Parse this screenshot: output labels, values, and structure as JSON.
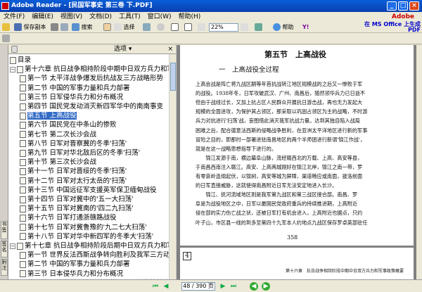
{
  "window": {
    "title": "Adobe Reader - [民国军事史 第三卷 下.PDF]",
    "min": "_",
    "max": "□",
    "close": "×"
  },
  "menu": {
    "items": [
      "文件(F)",
      "编辑(E)",
      "视图(V)",
      "文档(D)",
      "工具(T)",
      "窗口(W)",
      "帮助(H)"
    ],
    "brand": "Adobe"
  },
  "toolbar1": {
    "save_copy": "保存副本",
    "search": "搜索",
    "select": "选择",
    "zoom": "22%",
    "help": "帮助",
    "yahoo": "Y!"
  },
  "ad": {
    "line1": "在 MS Office 上生成",
    "line2": "PDF"
  },
  "sidebar": {
    "options": "选项",
    "tabs": [
      "书签",
      "签名",
      "附注"
    ],
    "items": [
      {
        "label": "目录",
        "level": 0,
        "toggle": ""
      },
      {
        "label": "第十六章 抗日战争相持阶段中期中日双方兵力和军",
        "level": 0,
        "toggle": "−"
      },
      {
        "label": "第一节 太平洋战争爆发后抗战友三方战略形势",
        "level": 1,
        "toggle": ""
      },
      {
        "label": "第二节 中国的军事力量和兵力部署",
        "level": 1,
        "toggle": ""
      },
      {
        "label": "第三节 日军侵华兵力和分布概况",
        "level": 1,
        "toggle": ""
      },
      {
        "label": "第四节 国民党发动消灭新四军华中的南南事变",
        "level": 1,
        "toggle": ""
      },
      {
        "label": "第五节 上高战役",
        "level": 1,
        "toggle": "",
        "selected": true
      },
      {
        "label": "第六节 国民党在中条山的惨败",
        "level": 1,
        "toggle": ""
      },
      {
        "label": "第七节 第二次长沙会战",
        "level": 1,
        "toggle": ""
      },
      {
        "label": "第八节 日军对晋察冀的冬季'扫荡'",
        "level": 1,
        "toggle": ""
      },
      {
        "label": "第九节 日军对华北敌后区的冬季'扫荡'",
        "level": 1,
        "toggle": ""
      },
      {
        "label": "第十节 第三次长沙会战",
        "level": 1,
        "toggle": ""
      },
      {
        "label": "第十一节 日军对晋绥的冬季'扫荡'",
        "level": 1,
        "toggle": ""
      },
      {
        "label": "第十二节 日军对太行太岳的'扫荡'",
        "level": 1,
        "toggle": ""
      },
      {
        "label": "第十三节 中国远征军支援英军保卫缅甸战役",
        "level": 1,
        "toggle": ""
      },
      {
        "label": "第十四节 日军对冀中的'五一大扫荡'",
        "level": 1,
        "toggle": ""
      },
      {
        "label": "第十五节 日军对冀南的'四二九扫荡'",
        "level": 1,
        "toggle": ""
      },
      {
        "label": "第十六节 日军打通浙赣路战役",
        "level": 1,
        "toggle": ""
      },
      {
        "label": "第十七节 日军对冀鲁豫的'九二七大扫荡'",
        "level": 1,
        "toggle": ""
      },
      {
        "label": "第十八节 日军对华中新四军的冬季大'扫荡'",
        "level": 1,
        "toggle": ""
      },
      {
        "label": "第十七章 抗日战争相持阶段后期中日双方兵力和军",
        "level": 0,
        "toggle": "−"
      },
      {
        "label": "第一节 世界反法西斯战争转向胜利及我军三方动",
        "level": 1,
        "toggle": ""
      },
      {
        "label": "第二节 中国的军事力量和兵力部署",
        "level": 1,
        "toggle": ""
      },
      {
        "label": "第三节 日本侵华兵力和分布概况",
        "level": 1,
        "toggle": ""
      },
      {
        "label": "第四节 雪峰带带八路军讨伐的顽固、扩获抗战会",
        "level": 1,
        "toggle": ""
      }
    ]
  },
  "document": {
    "section_title": "第五节　上高战役",
    "subtitle": "一　上高战役全过程",
    "paragraphs": [
      "上高会战是阵亡将九战区嗣等年首抗战转江地区规模战的之后又一惨败于军",
      "的战役。1938年冬，日军攻破武汉、广州、南昌后，随然领华兵力已日益不",
      "但由于战线过长，又加上抗占区人民群众开展抗日游击战，再也无力发起大",
      "规模的全面进攻，为保护其占领区，那采取以巩固占领区为主的战略，不时游",
      "兵力对抗进行'扫荡'战，妄图借此消灭我军抗战力量。达到其独自陷入战局",
      "困难之后，配合德意法西斯的侵略战争胜利，在亚洲太平洋地区进行新的军事",
      "冒险之目的，即那时一部署进驻南昌地区的两个半师团进行新谓'锦江作战'，",
      "就是在这一战略思想指导下进行的。",
      "　　锦江发源于南，横边幕阜山脉，流经赣西北的万载、上高、高安等县，",
      "于南昌西南注入赣江。高安、上高两城刚好在锦江北岸，锦江之南一带，罗",
      "有零崇岭连绵起伏，以锦树，高安等城为屏障，渠道畅应或南面，拔洛前面",
      "的日军直接威胁，这就使得南昌附近日军无法安定地进入长沙。",
      "　　锦江、抚河流域地区则是我军第九战区和第三战区接合部。南昌、罗",
      "阜是为战役地区之中，日军以最国民党政府重兵的持续推进期，上高附近",
      "侵在部的实力伤亡战之状，还被日军打有机会进入，上高附近也据点，只约",
      "叶子山，市区县一线的到多至第四十九军本人约地点九战区保存罗卓英部驻任"
    ],
    "page_number": "358",
    "next_page_header": "第十六章　抗日战争相持阶段中期中日双方兵力和军事政策概要"
  },
  "status": {
    "page_display": "48 / 390 页"
  }
}
